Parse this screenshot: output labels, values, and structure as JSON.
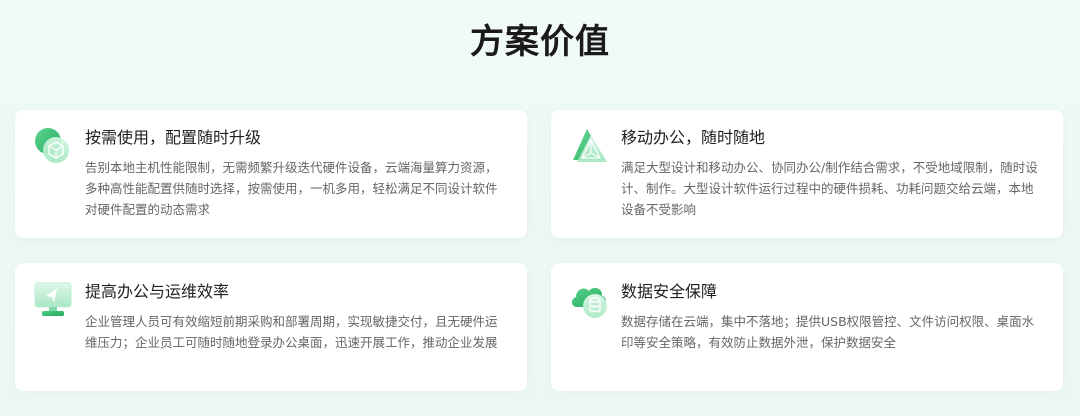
{
  "section": {
    "title": "方案价值"
  },
  "cards": [
    {
      "icon": "cube-cloud-icon",
      "title": "按需使用，配置随时升级",
      "desc": "告别本地主机性能限制，无需频繁升级迭代硬件设备，云端海量算力资源，多种高性能配置供随时选择，按需使用，一机多用，轻松满足不同设计软件对硬件配置的动态需求"
    },
    {
      "icon": "pyramid-icon",
      "title": "移动办公，随时随地",
      "desc": "满足大型设计和移动办公、协同办公/制作结合需求，不受地域限制，随时设计、制作。大型设计软件运行过程中的硬件损耗、功耗问题交给云端，本地设备不受影响"
    },
    {
      "icon": "monitor-send-icon",
      "title": "提高办公与运维效率",
      "desc": "企业管理人员可有效缩短前期采购和部署周期，实现敏捷交付，且无硬件运维压力；企业员工可随时随地登录办公桌面，迅速开展工作，推动企业发展"
    },
    {
      "icon": "cloud-database-icon",
      "title": "数据安全保障",
      "desc": "数据存储在云端，集中不落地；提供USB权限管控、文件访问权限、桌面水印等安全策略，有效防止数据外泄，保护数据安全"
    }
  ],
  "colors": {
    "accent": "#2fbf71",
    "accent_light": "#8fe3b5",
    "background": "#eef8f3"
  }
}
